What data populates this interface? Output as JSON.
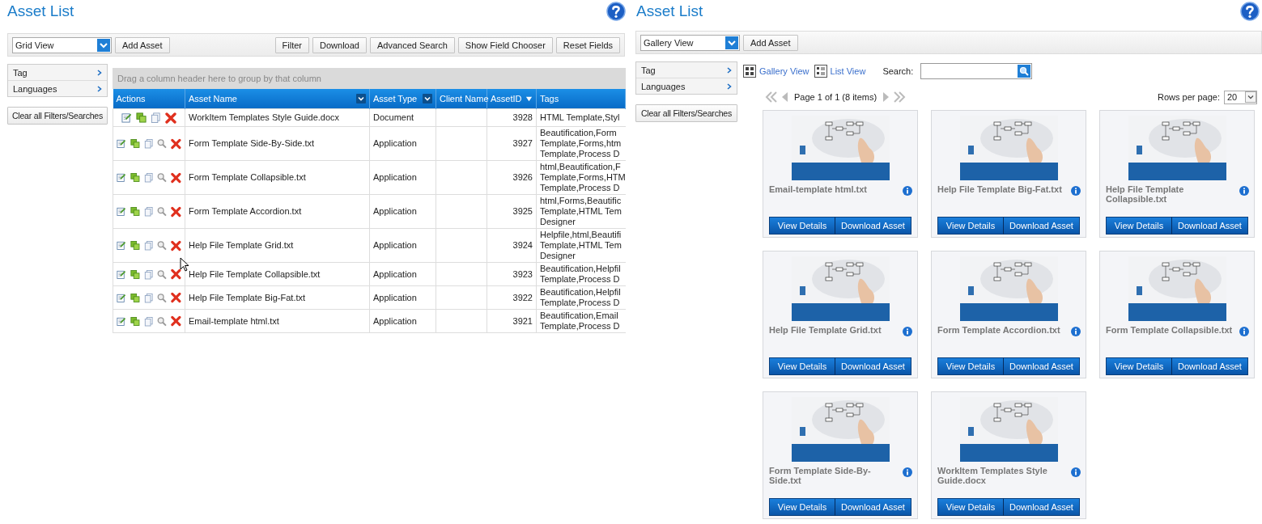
{
  "left": {
    "title": "Asset List",
    "view_select": "Grid View",
    "add_button": "Add Asset",
    "toolbar_buttons": [
      "Filter",
      "Download",
      "Advanced Search",
      "Show Field Chooser",
      "Reset Fields"
    ],
    "filters": [
      {
        "label": "Tag"
      },
      {
        "label": "Languages"
      }
    ],
    "clear_button": "Clear all Filters/Searches",
    "group_hint": "Drag a column header here to group by that column",
    "columns": [
      {
        "label": "Actions",
        "kind": "plain"
      },
      {
        "label": "Asset Name",
        "kind": "menu"
      },
      {
        "label": "Asset Type",
        "kind": "menu"
      },
      {
        "label": "Client Name",
        "kind": "plain"
      },
      {
        "label": "AssetID",
        "kind": "sort"
      },
      {
        "label": "Tags",
        "kind": "plain"
      }
    ],
    "rows": [
      {
        "actions": [
          {
            "kind": "edit"
          },
          {
            "kind": "copy"
          },
          {
            "kind": "clone"
          },
          {
            "kind": "delete"
          }
        ],
        "name": "WorkItem Templates Style Guide.docx",
        "type": "Document",
        "asset_id": "3928",
        "tags": [
          "HTML Template,Styl"
        ]
      },
      {
        "actions": [
          {
            "kind": "edit"
          },
          {
            "kind": "copy"
          },
          {
            "kind": "clone"
          },
          {
            "kind": "view"
          },
          {
            "kind": "delete"
          }
        ],
        "name": "Form Template Side-By-Side.txt",
        "type": "Application",
        "asset_id": "3927",
        "tags": [
          "Beautification,Form",
          "Template,Forms,htm",
          "Template,Process D"
        ]
      },
      {
        "actions": [
          {
            "kind": "edit"
          },
          {
            "kind": "copy"
          },
          {
            "kind": "clone"
          },
          {
            "kind": "view"
          },
          {
            "kind": "delete"
          }
        ],
        "name": "Form Template Collapsible.txt",
        "type": "Application",
        "asset_id": "3926",
        "tags": [
          "html,Beautification,F",
          "Template,Forms,HTM",
          "Template,Process D"
        ]
      },
      {
        "actions": [
          {
            "kind": "edit"
          },
          {
            "kind": "copy"
          },
          {
            "kind": "clone"
          },
          {
            "kind": "view"
          },
          {
            "kind": "delete"
          }
        ],
        "name": "Form Template Accordion.txt",
        "type": "Application",
        "asset_id": "3925",
        "tags": [
          "html,Forms,Beautific",
          "Template,HTML Tem",
          "Designer"
        ]
      },
      {
        "actions": [
          {
            "kind": "edit"
          },
          {
            "kind": "copy"
          },
          {
            "kind": "clone"
          },
          {
            "kind": "view"
          },
          {
            "kind": "delete"
          }
        ],
        "name": "Help File Template Grid.txt",
        "type": "Application",
        "asset_id": "3924",
        "tags": [
          "Helpfile,html,Beautifi",
          "Template,HTML Tem",
          "Designer"
        ]
      },
      {
        "actions": [
          {
            "kind": "edit"
          },
          {
            "kind": "copy"
          },
          {
            "kind": "clone"
          },
          {
            "kind": "view"
          },
          {
            "kind": "delete"
          }
        ],
        "name": "Help File Template Collapsible.txt",
        "type": "Application",
        "asset_id": "3923",
        "tags": [
          "Beautification,Helpfil",
          "Template,Process D"
        ]
      },
      {
        "actions": [
          {
            "kind": "edit"
          },
          {
            "kind": "copy"
          },
          {
            "kind": "clone"
          },
          {
            "kind": "view"
          },
          {
            "kind": "delete"
          }
        ],
        "name": "Help File Template Big-Fat.txt",
        "type": "Application",
        "asset_id": "3922",
        "tags": [
          "Beautification,Helpfil",
          "Template,Process D"
        ]
      },
      {
        "actions": [
          {
            "kind": "edit"
          },
          {
            "kind": "copy"
          },
          {
            "kind": "clone"
          },
          {
            "kind": "view"
          },
          {
            "kind": "delete"
          }
        ],
        "name": "Email-template html.txt",
        "type": "Application",
        "asset_id": "3921",
        "tags": [
          "Beautification,Email",
          "Template,Process D"
        ]
      }
    ]
  },
  "right": {
    "title": "Asset List",
    "view_select": "Gallery View",
    "add_button": "Add Asset",
    "filters": [
      {
        "label": "Tag"
      },
      {
        "label": "Languages"
      }
    ],
    "clear_button": "Clear all Filters/Searches",
    "view_links": [
      {
        "kind": "gallery",
        "label": "Gallery View"
      },
      {
        "kind": "list",
        "label": "List View"
      }
    ],
    "search_label": "Search:",
    "pager": {
      "info": "Page 1 of 1 (8 items)",
      "rows_label": "Rows per page:",
      "rows_value": "20"
    },
    "cards": [
      {
        "title": "Email-template html.txt",
        "buttons": [
          "View Details",
          "Download Asset"
        ]
      },
      {
        "title": "Help File Template Big-Fat.txt",
        "buttons": [
          "View Details",
          "Download Asset"
        ]
      },
      {
        "title": "Help File Template Collapsible.txt",
        "buttons": [
          "View Details",
          "Download Asset"
        ]
      },
      {
        "title": "Help File Template Grid.txt",
        "buttons": [
          "View Details",
          "Download Asset"
        ]
      },
      {
        "title": "Form Template Accordion.txt",
        "buttons": [
          "View Details",
          "Download Asset"
        ]
      },
      {
        "title": "Form Template Collapsible.txt",
        "buttons": [
          "View Details",
          "Download Asset"
        ]
      },
      {
        "title": "Form Template Side-By-Side.txt",
        "buttons": [
          "View Details",
          "Download Asset"
        ]
      },
      {
        "title": "WorkItem Templates Style Guide.docx",
        "buttons": [
          "View Details",
          "Download Asset"
        ]
      }
    ]
  }
}
